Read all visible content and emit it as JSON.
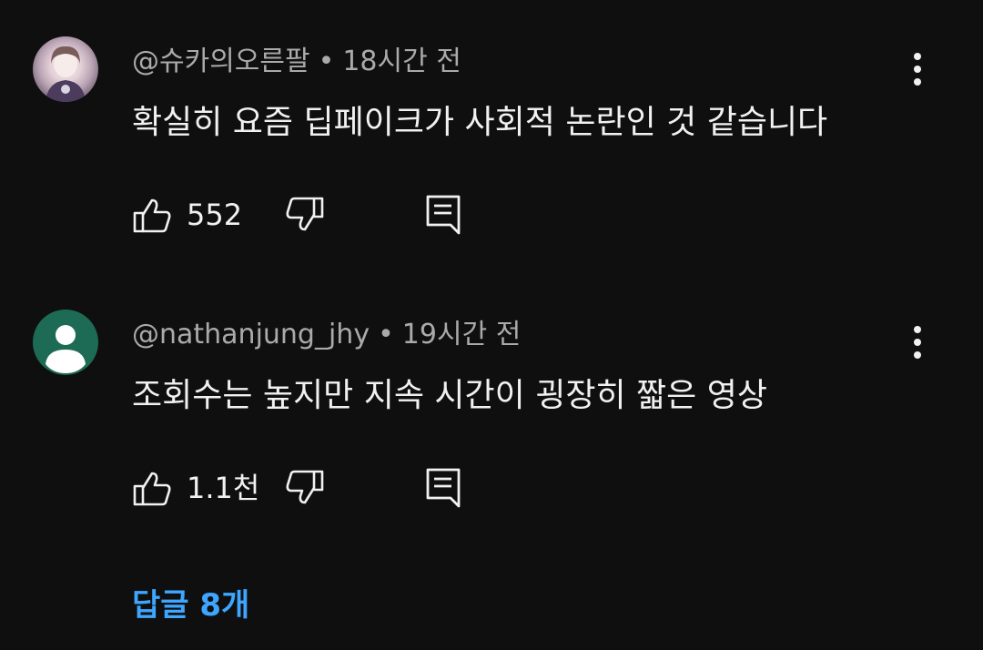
{
  "comments": [
    {
      "handle": "@슈카의오른팔",
      "separator": "•",
      "time": "18시간 전",
      "text": "확실히 요즘 딥페이크가 사회적 논란인 것 같습니다",
      "likes": "552",
      "avatar_type": "photo"
    },
    {
      "handle": "@nathanjung_jhy",
      "separator": "•",
      "time": "19시간 전",
      "text": "조회수는 높지만 지속 시간이 굉장히 짧은 영상",
      "likes": "1.1천",
      "avatar_type": "default-person",
      "avatar_color": "#1d6b54"
    }
  ],
  "replies_link": "답글 8개",
  "colors": {
    "background": "#0f0f0f",
    "text_primary": "#f1f1f1",
    "text_secondary": "#aaaaaa",
    "link_blue": "#3ea6ff"
  },
  "icons": [
    "thumb-up-icon",
    "thumb-down-icon",
    "reply-icon",
    "more-vert-icon",
    "person-icon"
  ]
}
